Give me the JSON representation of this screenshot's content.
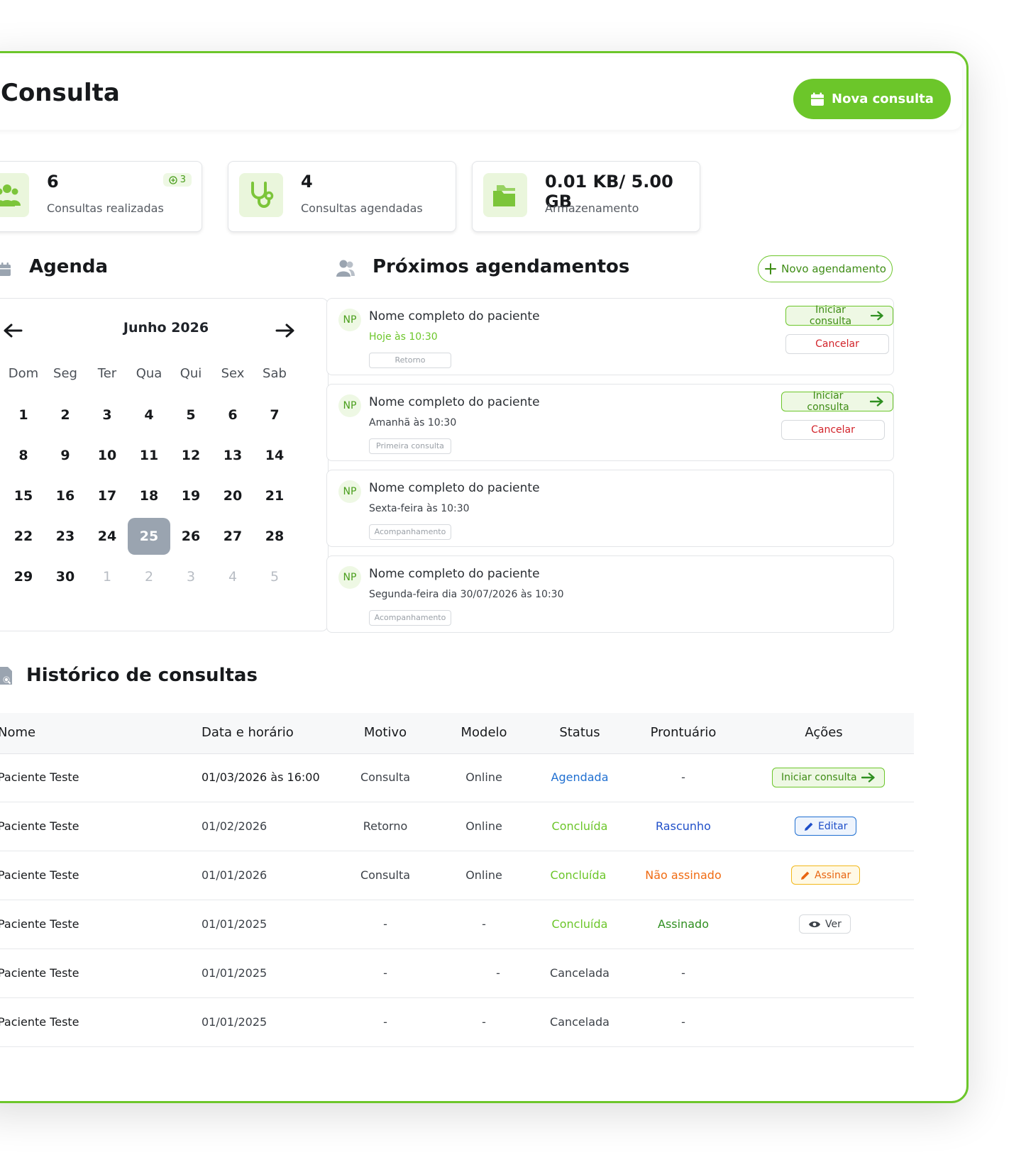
{
  "header": {
    "title": "Consulta",
    "new_button": "Nova consulta"
  },
  "stats": [
    {
      "value": "6",
      "label": "Consultas realizadas",
      "badge": "3"
    },
    {
      "value": "4",
      "label": "Consultas agendadas"
    },
    {
      "value": "0.01 KB/ 5.00 GB",
      "label": "Armazenamento"
    }
  ],
  "agenda": {
    "title": "Agenda",
    "month": "Junho 2026",
    "weekdays": [
      "Dom",
      "Seg",
      "Ter",
      "Qua",
      "Qui",
      "Sex",
      "Sab"
    ],
    "days": [
      "1",
      "2",
      "3",
      "4",
      "5",
      "6",
      "7",
      "8",
      "9",
      "10",
      "11",
      "12",
      "13",
      "14",
      "15",
      "16",
      "17",
      "18",
      "19",
      "20",
      "21",
      "22",
      "23",
      "24",
      "25",
      "26",
      "27",
      "28",
      "29",
      "30",
      "1",
      "2",
      "3",
      "4",
      "5"
    ],
    "selected_day": "25"
  },
  "upcoming": {
    "title": "Próximos agendamentos",
    "new_button": "Novo agendamento",
    "start_label": "Iniciar consulta",
    "cancel_label": "Cancelar",
    "items": [
      {
        "initials": "NP",
        "name": "Nome completo do paciente",
        "time": "Hoje às 10:30",
        "tag": "Retorno"
      },
      {
        "initials": "NP",
        "name": "Nome completo do paciente",
        "time": "Amanhã às 10:30",
        "tag": "Primeira consulta"
      },
      {
        "initials": "NP",
        "name": "Nome completo do paciente",
        "time": "Sexta-feira às 10:30",
        "tag": "Acompanhamento"
      },
      {
        "initials": "NP",
        "name": "Nome completo do paciente",
        "time": "Segunda-feira dia 30/07/2026 às 10:30",
        "tag": "Acompanhamento"
      }
    ]
  },
  "history": {
    "title": "Histórico de consultas",
    "columns": [
      "Nome",
      "Data e horário",
      "Motivo",
      "Modelo",
      "Status",
      "Prontuário",
      "Ações"
    ],
    "rows": [
      {
        "name": "Paciente Teste",
        "date": "01/03/2026 às 16:00",
        "reason": "Consulta",
        "model": "Online",
        "status": "Agendada",
        "record": "-",
        "action": "Iniciar consulta"
      },
      {
        "name": "Paciente Teste",
        "date": "01/02/2026",
        "reason": "Retorno",
        "model": "Online",
        "status": "Concluída",
        "record": "Rascunho",
        "action": "Editar"
      },
      {
        "name": "Paciente Teste",
        "date": "01/01/2026",
        "reason": "Consulta",
        "model": "Online",
        "status": "Concluída",
        "record": "Não assinado",
        "action": "Assinar"
      },
      {
        "name": "Paciente Teste",
        "date": "01/01/2025",
        "reason": "-",
        "model": "-",
        "status": "Concluída",
        "record": "Assinado",
        "action": "Ver"
      },
      {
        "name": "Paciente Teste",
        "date": "01/01/2025",
        "reason": "-",
        "model": "-",
        "status": "Cancelada",
        "record": "-",
        "action": ""
      },
      {
        "name": "Paciente Teste",
        "date": "01/01/2025",
        "reason": "-",
        "model": "-",
        "status": "Cancelada",
        "record": "-",
        "action": ""
      }
    ]
  },
  "colors": {
    "accent": "#6cc62a",
    "blue": "#1f6fd1",
    "orange": "#f06b12",
    "red": "#d2232a"
  }
}
